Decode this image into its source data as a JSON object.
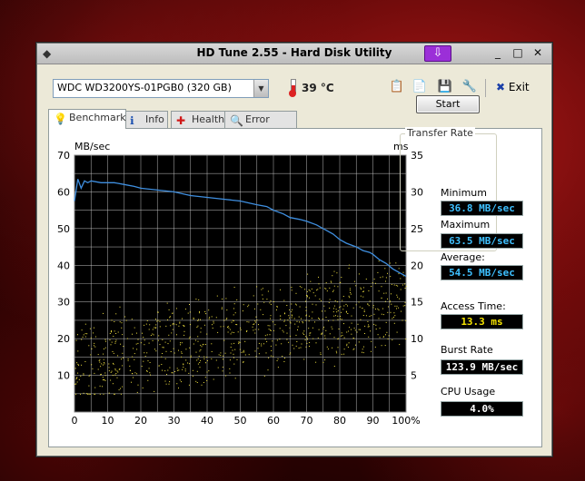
{
  "window": {
    "title": "HD Tune 2.55 - Hard Disk Utility",
    "controls": {
      "minimize": "_",
      "maximize": "□",
      "close": "✕"
    }
  },
  "toolbar": {
    "drive": "WDC WD3200YS-01PGB0 (320 GB)",
    "temperature": "39 °C",
    "exit_label": "Exit",
    "icons": [
      "copy-text-icon",
      "copy-screenshot-icon",
      "save-icon",
      "options-icon"
    ]
  },
  "tabs": [
    {
      "label": "Benchmark",
      "icon": "lightbulb-icon",
      "active": true
    },
    {
      "label": "Info",
      "icon": "info-icon"
    },
    {
      "label": "Health",
      "icon": "health-cross-icon"
    },
    {
      "label": "Error Scan",
      "icon": "magnifier-icon"
    }
  ],
  "actions": {
    "start_label": "Start"
  },
  "stats": {
    "transfer_rate_title": "Transfer Rate",
    "minimum_label": "Minimum",
    "minimum_value": "36.8 MB/sec",
    "maximum_label": "Maximum",
    "maximum_value": "63.5 MB/sec",
    "average_label": "Average:",
    "average_value": "54.5 MB/sec",
    "access_time_label": "Access Time:",
    "access_time_value": "13.3 ms",
    "burst_rate_label": "Burst Rate",
    "burst_rate_value": "123.9 MB/sec",
    "cpu_label": "CPU Usage",
    "cpu_value": "4.0%"
  },
  "colors": {
    "transfer_line": "#3f8fe0",
    "access_dots": "#f0e040",
    "chart_bg": "#000000",
    "grid": "#d0d0d0"
  },
  "chart_data": {
    "type": "line",
    "left_unit": "MB/sec",
    "right_unit": "ms",
    "ylim_left": [
      0,
      70
    ],
    "ylim_right": [
      0,
      35
    ],
    "xlim": [
      0,
      100
    ],
    "left_ticks": [
      "10",
      "20",
      "30",
      "40",
      "50",
      "60",
      "70"
    ],
    "right_ticks": [
      "5",
      "10",
      "15",
      "20",
      "25",
      "30",
      "35"
    ],
    "x_ticks": [
      "0",
      "10",
      "20",
      "30",
      "40",
      "50",
      "60",
      "70",
      "80",
      "90",
      "100%"
    ],
    "series": [
      {
        "name": "Transfer Rate",
        "x": [
          0,
          1,
          2,
          3,
          4,
          5,
          8,
          12,
          15,
          18,
          20,
          25,
          30,
          35,
          40,
          45,
          50,
          55,
          58,
          60,
          63,
          65,
          68,
          70,
          73,
          75,
          78,
          80,
          82,
          85,
          87,
          89,
          90,
          92,
          94,
          96,
          98,
          100
        ],
        "y": [
          57.5,
          63.5,
          61.0,
          63.0,
          62.5,
          63.0,
          62.5,
          62.5,
          62.0,
          61.5,
          61.0,
          60.5,
          60.0,
          59.0,
          58.5,
          58.0,
          57.5,
          56.5,
          56.0,
          55.0,
          54.0,
          53.0,
          52.5,
          52.0,
          51.0,
          50.0,
          48.5,
          47.0,
          46.0,
          45.0,
          44.0,
          43.5,
          43.0,
          41.5,
          40.5,
          39.0,
          38.0,
          37.0
        ]
      }
    ],
    "access_time_scatter": {
      "unit": "ms",
      "description_range_ms": [
        3,
        24
      ]
    }
  }
}
